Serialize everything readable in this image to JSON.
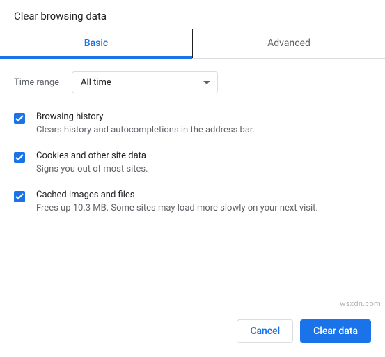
{
  "title": "Clear browsing data",
  "tabs": {
    "basic": "Basic",
    "advanced": "Advanced"
  },
  "timerange": {
    "label": "Time range",
    "value": "All time"
  },
  "options": [
    {
      "title": "Browsing history",
      "desc": "Clears history and autocompletions in the address bar.",
      "checked": true
    },
    {
      "title": "Cookies and other site data",
      "desc": "Signs you out of most sites.",
      "checked": true
    },
    {
      "title": "Cached images and files",
      "desc": "Frees up 10.3 MB. Some sites may load more slowly on your next visit.",
      "checked": true
    }
  ],
  "buttons": {
    "cancel": "Cancel",
    "clear": "Clear data"
  },
  "watermark": "wsxdn.com"
}
